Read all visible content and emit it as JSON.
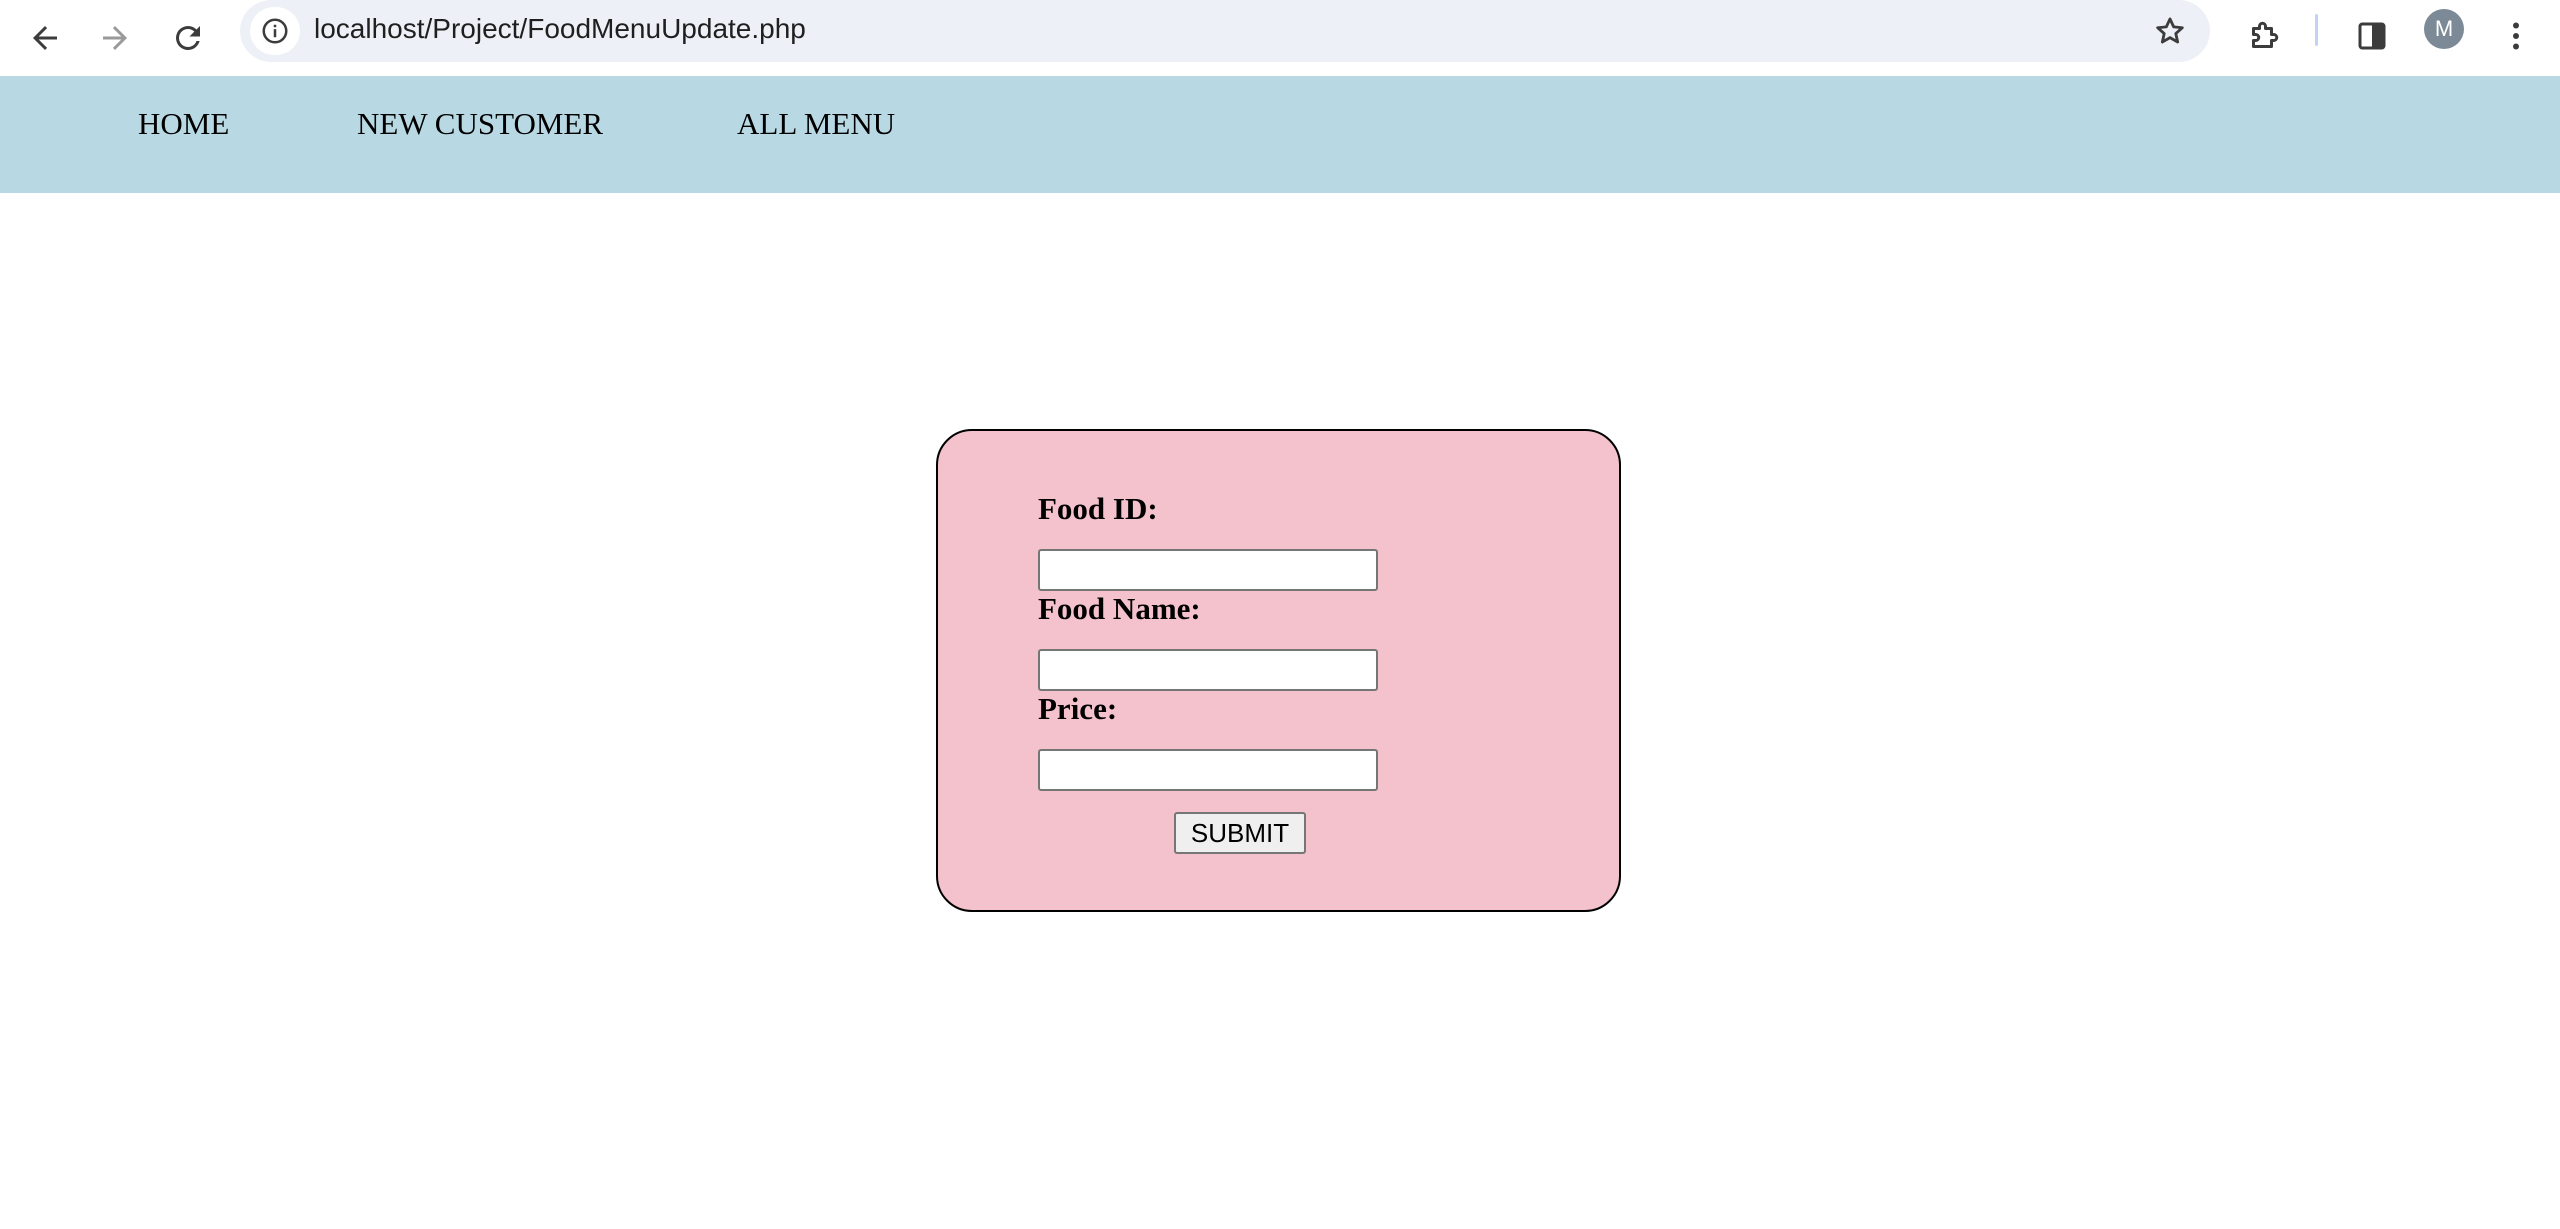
{
  "browser": {
    "url": "localhost/Project/FoodMenuUpdate.php",
    "profile_initial": "M",
    "icons": {
      "back": "arrow-left-icon",
      "forward": "arrow-right-icon",
      "reload": "reload-icon",
      "site_info": "info-circle-icon",
      "bookmark": "star-icon",
      "extensions": "puzzle-icon",
      "side_panel": "side-panel-icon",
      "menu": "kebab-menu-icon"
    }
  },
  "nav": {
    "items": [
      {
        "label": "HOME"
      },
      {
        "label": "NEW CUSTOMER"
      },
      {
        "label": "ALL MENU"
      }
    ]
  },
  "form": {
    "food_id": {
      "label": "Food ID:",
      "value": ""
    },
    "food_name": {
      "label": "Food Name:",
      "value": ""
    },
    "price": {
      "label": "Price:",
      "value": ""
    },
    "submit_label": "SUBMIT"
  },
  "colors": {
    "navbar_bg": "#b8d9e4",
    "card_bg": "#f4c2cc",
    "omnibox_bg": "#edf0f6"
  }
}
